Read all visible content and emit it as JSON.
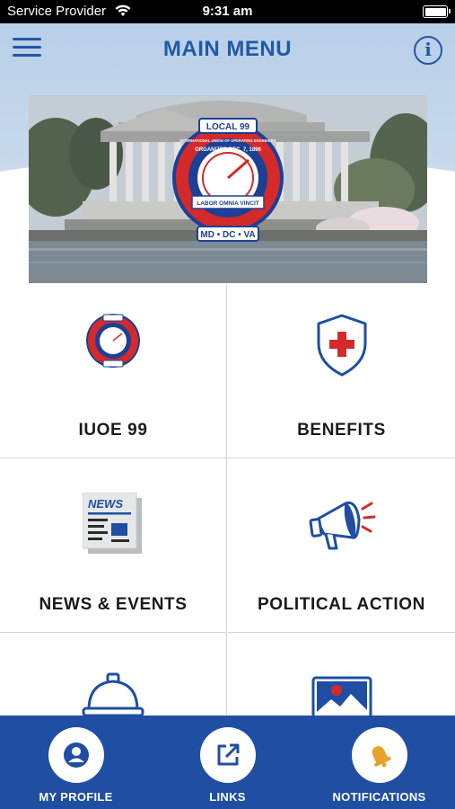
{
  "status_bar": {
    "carrier": "Service Provider",
    "time": "9:31 am"
  },
  "header": {
    "title": "MAIN MENU",
    "menu_icon": "hamburger-icon",
    "info_icon": "info-icon",
    "info_glyph": "i"
  },
  "banner": {
    "logo": {
      "top_text": "LOCAL 99",
      "ring_text": "INTERNATIONAL UNION OF OPERATING ENGINEERS",
      "inner_text": "ORGANIZED DEC. 7, 1896",
      "motto": "LABOR OMNIA VINCIT",
      "bottom_text": "MD • DC • VA"
    }
  },
  "tiles": [
    {
      "label": "IUOE 99",
      "icon": "union-seal-icon"
    },
    {
      "label": "BENEFITS",
      "icon": "shield-cross-icon"
    },
    {
      "label": "NEWS & EVENTS",
      "icon": "newspaper-icon",
      "icon_text": "NEWS"
    },
    {
      "label": "POLITICAL ACTION",
      "icon": "megaphone-icon"
    },
    {
      "label": "",
      "icon": "hard-hat-icon"
    },
    {
      "label": "",
      "icon": "photo-gallery-icon"
    }
  ],
  "bottom_nav": [
    {
      "label": "MY PROFILE",
      "icon": "user-profile-icon"
    },
    {
      "label": "LINKS",
      "icon": "external-link-icon"
    },
    {
      "label": "NOTIFICATIONS",
      "icon": "bell-icon"
    }
  ],
  "colors": {
    "brand_blue": "#1f4ea3",
    "title_blue": "#1f5aa6",
    "accent_red": "#d42a2a",
    "bell_gold": "#e9a12b"
  }
}
